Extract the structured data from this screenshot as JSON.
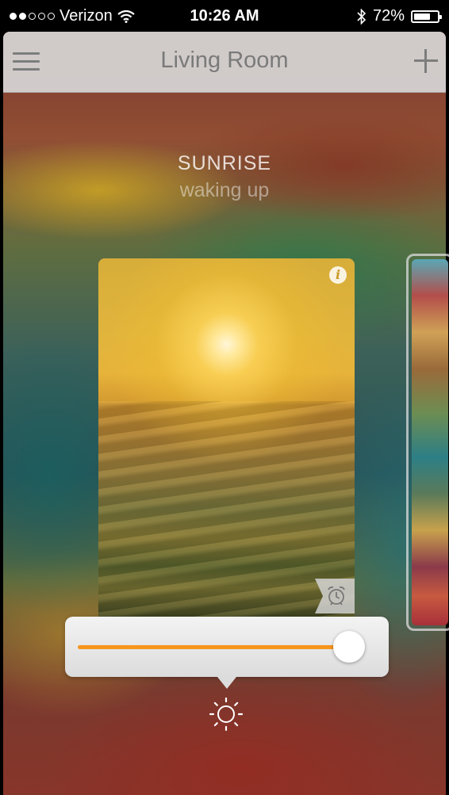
{
  "status_bar": {
    "carrier": "Verizon",
    "signal_bars_filled": 2,
    "signal_bars_total": 5,
    "time": "10:26 AM",
    "battery_percent": "72%",
    "battery_level": 0.72
  },
  "nav": {
    "title": "Living Room",
    "menu_icon": "hamburger-menu-icon",
    "add_icon": "plus-icon"
  },
  "scene": {
    "title": "SUNRISE",
    "subtitle": "waking up",
    "info_label": "i",
    "alarm_icon": "alarm-clock-icon"
  },
  "brightness": {
    "level": 0.95,
    "accent_color": "#f7951b",
    "icon": "sun-icon"
  }
}
